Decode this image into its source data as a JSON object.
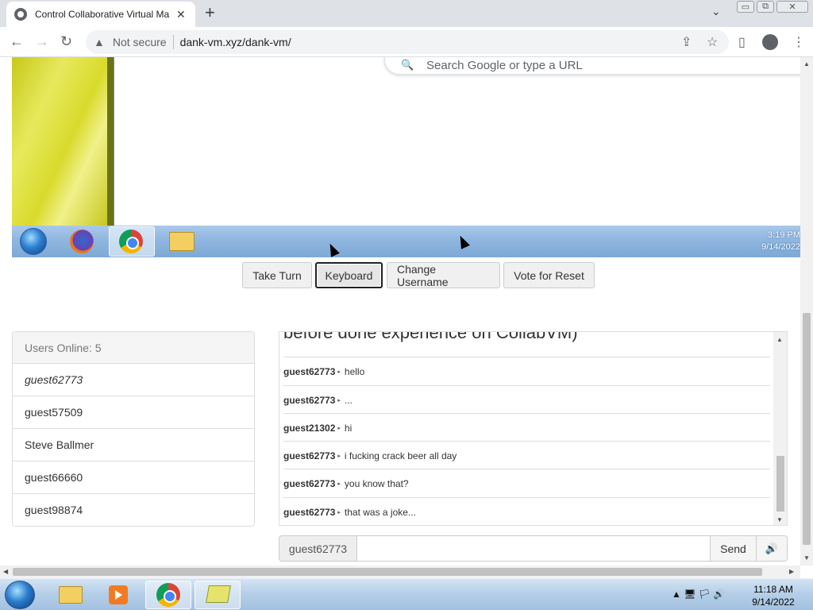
{
  "browser": {
    "tab_title": "Control Collaborative Virtual Ma",
    "tab_close": "✕",
    "new_tab": "+",
    "tab_search": "⌄",
    "window_controls": [
      "▭",
      "⧉",
      "✕"
    ],
    "security_label": "Not secure",
    "url": "dank-vm.xyz/dank-vm/",
    "back": "←",
    "forward": "→",
    "reload": "↻"
  },
  "vm": {
    "search_placeholder": "Search Google or type a URL",
    "clock_time": "3:19 PM",
    "clock_date": "9/14/2022",
    "wallpaper_color": "#d9da2c",
    "taskbar_color": "#8fb6df"
  },
  "controls": {
    "take_turn": "Take Turn",
    "keyboard": "Keyboard",
    "change_username": "Change Username",
    "vote_reset": "Vote for Reset"
  },
  "users": {
    "header": "Users Online: 5",
    "list": [
      "guest62773",
      "guest57509",
      "Steve Ballmer",
      "guest66660",
      "guest98874"
    ]
  },
  "chat": {
    "overflow_text": "before done experience on CollabVM)",
    "messages": [
      {
        "user": "guest62773",
        "text": "hello"
      },
      {
        "user": "guest62773",
        "text": "..."
      },
      {
        "user": "guest21302",
        "text": "hi"
      },
      {
        "user": "guest62773",
        "text": "i fucking crack beer all day"
      },
      {
        "user": "guest62773",
        "text": "you know that?"
      },
      {
        "user": "guest62773",
        "text": "that was a joke..."
      }
    ]
  },
  "chat_input": {
    "username": "guest62773",
    "value": "",
    "send": "Send",
    "volume_icon": "🔊"
  },
  "taskbar": {
    "time": "11:18 AM",
    "date": "9/14/2022",
    "tray_icons": "▲ 🖥 🏳 🔊"
  }
}
